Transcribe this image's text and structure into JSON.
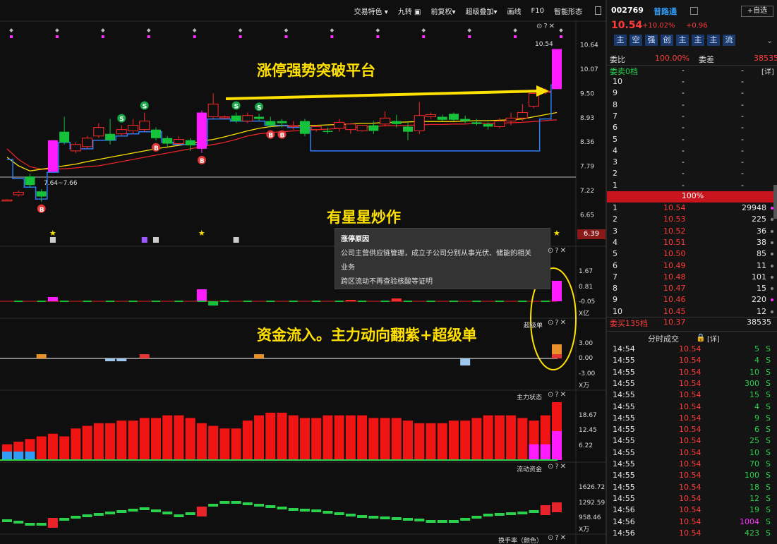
{
  "toolbar": {
    "items": [
      "交易特色",
      "九转",
      "前复权",
      "超级叠加",
      "画线",
      "F10",
      "智能形态"
    ]
  },
  "chart_data": {
    "type": "candlestick",
    "price_axis": [
      "10.64",
      "10.07",
      "9.50",
      "8.93",
      "8.36",
      "7.79",
      "7.22",
      "6.65"
    ],
    "price_range": [
      6.36,
      10.78
    ],
    "high_label": "10.54",
    "low_label": "7.64~7.66",
    "current_price_badge": "6.39",
    "candles": [
      {
        "o": 7.0,
        "c": 7.0,
        "h": 7.02,
        "l": 6.98
      },
      {
        "o": 7.12,
        "c": 7.18,
        "h": 7.22,
        "l": 7.08
      },
      {
        "o": 7.55,
        "c": 7.35,
        "h": 7.62,
        "l": 7.3
      },
      {
        "o": 7.2,
        "c": 7.08,
        "h": 7.25,
        "l": 6.96
      },
      {
        "o": 7.66,
        "c": 8.4,
        "h": 8.4,
        "l": 7.64
      },
      {
        "o": 8.6,
        "c": 8.35,
        "h": 8.95,
        "l": 8.3
      },
      {
        "o": 8.15,
        "c": 8.3,
        "h": 8.35,
        "l": 8.1
      },
      {
        "o": 8.25,
        "c": 8.45,
        "h": 8.5,
        "l": 8.2
      },
      {
        "o": 8.5,
        "c": 8.7,
        "h": 8.8,
        "l": 8.45
      },
      {
        "o": 8.55,
        "c": 8.4,
        "h": 8.9,
        "l": 8.3
      },
      {
        "o": 8.55,
        "c": 8.65,
        "h": 8.75,
        "l": 8.5
      },
      {
        "o": 8.62,
        "c": 8.75,
        "h": 8.9,
        "l": 8.55
      },
      {
        "o": 8.65,
        "c": 8.85,
        "h": 9.05,
        "l": 8.6
      },
      {
        "o": 8.65,
        "c": 8.45,
        "h": 8.7,
        "l": 8.4
      },
      {
        "o": 8.45,
        "c": 8.32,
        "h": 8.5,
        "l": 8.25
      },
      {
        "o": 8.32,
        "c": 8.42,
        "h": 8.5,
        "l": 8.3
      },
      {
        "o": 8.4,
        "c": 8.28,
        "h": 8.45,
        "l": 8.15
      },
      {
        "o": 8.2,
        "c": 9.05,
        "h": 9.1,
        "l": 8.1
      },
      {
        "o": 8.95,
        "c": 9.25,
        "h": 9.5,
        "l": 8.9
      },
      {
        "o": 8.95,
        "c": 8.95,
        "h": 8.98,
        "l": 8.9
      },
      {
        "o": 8.98,
        "c": 8.85,
        "h": 9.05,
        "l": 8.8
      },
      {
        "o": 8.85,
        "c": 8.98,
        "h": 9.05,
        "l": 8.8
      },
      {
        "o": 8.95,
        "c": 8.9,
        "h": 9.02,
        "l": 8.85
      },
      {
        "o": 8.85,
        "c": 8.75,
        "h": 8.95,
        "l": 8.7
      },
      {
        "o": 8.85,
        "c": 8.8,
        "h": 8.9,
        "l": 8.7
      },
      {
        "o": 8.72,
        "c": 8.75,
        "h": 8.85,
        "l": 8.65
      },
      {
        "o": 8.85,
        "c": 8.55,
        "h": 8.9,
        "l": 8.5
      },
      {
        "o": 8.65,
        "c": 8.72,
        "h": 8.75,
        "l": 8.6
      },
      {
        "o": 8.62,
        "c": 8.6,
        "h": 8.7,
        "l": 8.55
      },
      {
        "o": 8.68,
        "c": 8.82,
        "h": 8.9,
        "l": 8.6
      },
      {
        "o": 8.65,
        "c": 8.78,
        "h": 8.8,
        "l": 8.55
      },
      {
        "o": 8.62,
        "c": 8.75,
        "h": 8.75,
        "l": 8.6
      },
      {
        "o": 8.75,
        "c": 8.62,
        "h": 8.85,
        "l": 8.55
      },
      {
        "o": 8.78,
        "c": 8.92,
        "h": 9.08,
        "l": 8.72
      },
      {
        "o": 8.85,
        "c": 8.78,
        "h": 9.0,
        "l": 8.7
      },
      {
        "o": 8.72,
        "c": 8.6,
        "h": 8.85,
        "l": 8.4
      },
      {
        "o": 8.62,
        "c": 8.98,
        "h": 9.3,
        "l": 8.55
      },
      {
        "o": 8.95,
        "c": 9.0,
        "h": 9.05,
        "l": 8.9
      },
      {
        "o": 8.95,
        "c": 8.88,
        "h": 9.0,
        "l": 8.85
      },
      {
        "o": 9.02,
        "c": 8.88,
        "h": 9.05,
        "l": 8.85
      },
      {
        "o": 8.9,
        "c": 8.85,
        "h": 8.98,
        "l": 8.8
      },
      {
        "o": 8.82,
        "c": 8.78,
        "h": 8.9,
        "l": 8.75
      },
      {
        "o": 8.78,
        "c": 8.72,
        "h": 8.82,
        "l": 8.65
      },
      {
        "o": 8.72,
        "c": 8.85,
        "h": 8.92,
        "l": 8.68
      },
      {
        "o": 8.85,
        "c": 8.92,
        "h": 9.05,
        "l": 8.75
      },
      {
        "o": 8.92,
        "c": 9.05,
        "h": 9.25,
        "l": 8.85
      },
      {
        "o": 9.2,
        "c": 9.5,
        "h": 9.55,
        "l": 9.15
      },
      {
        "o": 9.52,
        "c": 9.55,
        "h": 9.62,
        "l": 9.48
      },
      {
        "o": 9.6,
        "c": 10.54,
        "h": 10.54,
        "l": 9.6
      }
    ],
    "ma_yellow": [
      8.0,
      7.8,
      7.68,
      7.72,
      7.76,
      7.8,
      7.84,
      7.9,
      7.95,
      8.0,
      8.05,
      8.1,
      8.15,
      8.2,
      8.24,
      8.28,
      8.32,
      8.38,
      8.42,
      8.48,
      8.55,
      8.62,
      8.68,
      8.72,
      8.74,
      8.74,
      8.74,
      8.75,
      8.76,
      8.77,
      8.78,
      8.8,
      8.8,
      8.82,
      8.82,
      8.83,
      8.84,
      8.84,
      8.84,
      8.84,
      8.85,
      8.86,
      8.86,
      8.87,
      8.88,
      8.9,
      8.95,
      9.0,
      9.05
    ],
    "ma_red": [
      8.2,
      7.95,
      7.78,
      7.72,
      7.72,
      7.73,
      7.75,
      7.78,
      7.8,
      7.85,
      7.9,
      7.95,
      8.0,
      8.05,
      8.1,
      8.15,
      8.2,
      8.25,
      8.3,
      8.35,
      8.42,
      8.5,
      8.55,
      8.58,
      8.6,
      8.62,
      8.63,
      8.65,
      8.66,
      8.68,
      8.7,
      8.71,
      8.72,
      8.74,
      8.74,
      8.75,
      8.76,
      8.77,
      8.77,
      8.78,
      8.78,
      8.8,
      8.8,
      8.8,
      8.81,
      8.82,
      8.84,
      8.86,
      8.88
    ],
    "stop_line_blue": [
      7.95,
      7.5,
      7.3,
      7.02,
      7.65,
      8.35,
      8.2,
      8.2,
      8.4,
      8.4,
      8.5,
      8.55,
      8.6,
      8.6,
      8.35,
      8.3,
      8.3,
      8.3,
      8.9,
      8.9,
      8.85,
      8.85,
      8.85,
      8.75,
      8.75,
      8.7,
      8.7,
      8.15,
      8.15,
      8.15,
      8.15,
      8.15,
      8.15,
      8.15,
      8.15,
      8.15,
      8.15,
      8.15,
      8.15,
      8.15,
      8.15,
      8.15,
      8.15,
      8.15,
      8.15,
      8.15,
      8.15,
      8.9,
      9.7
    ],
    "signals": [
      {
        "i": 3,
        "t": "B",
        "pos": "below"
      },
      {
        "i": 10,
        "t": "S",
        "pos": "above"
      },
      {
        "i": 12,
        "t": "S",
        "pos": "above"
      },
      {
        "i": 13,
        "t": "B",
        "pos": "below"
      },
      {
        "i": 17,
        "t": "B",
        "pos": "below"
      },
      {
        "i": 20,
        "t": "S",
        "pos": "above"
      },
      {
        "i": 22,
        "t": "S",
        "pos": "above"
      },
      {
        "i": 23,
        "t": "B",
        "pos": "below"
      },
      {
        "i": 24,
        "t": "B",
        "pos": "below"
      }
    ],
    "panel2_axis": [
      "1.67",
      "0.81",
      "-0.05",
      "X亿"
    ],
    "panel3": {
      "title": "超级单",
      "axis": [
        "3.00",
        "0.00",
        "-3.00",
        "X万"
      ]
    },
    "panel4": {
      "title": "主力状态",
      "axis": [
        "18.67",
        "12.45",
        "6.22"
      ],
      "bars": [
        6,
        7,
        8,
        9,
        10,
        9,
        12,
        13,
        14,
        14,
        15,
        15,
        16,
        16,
        17,
        17,
        16,
        14,
        13,
        12,
        12,
        15,
        17,
        18,
        18,
        17,
        16,
        16,
        17,
        17,
        17,
        17,
        16,
        16,
        16,
        15,
        14,
        14,
        14,
        15,
        15,
        16,
        17,
        17,
        17,
        16,
        15,
        17,
        22
      ],
      "magenta": [
        0,
        0,
        0,
        0,
        0,
        0,
        0,
        0,
        0,
        0,
        0,
        0,
        0,
        0,
        0,
        0,
        0,
        0,
        0,
        0,
        0,
        0,
        0,
        0,
        0,
        0,
        0,
        0,
        0,
        0,
        0,
        0,
        0,
        0,
        0,
        0,
        0,
        0,
        0,
        0,
        0,
        0,
        0,
        0,
        0,
        0,
        6,
        6,
        11
      ]
    },
    "panel5": {
      "title": "流动资金",
      "axis": [
        "1626.72",
        "1292.59",
        "958.46",
        "X万"
      ]
    },
    "panel6": {
      "title": "换手率（颜色）"
    }
  },
  "annotations": {
    "a1": "涨停强势突破平台",
    "a2": "有星星炒作",
    "a3": "资金流入。主力动向翻紫+超级单"
  },
  "tooltip": {
    "title": "涨停原因",
    "line1": "公司主营供应链管理，成立子公司分别从事光伏、储能的相关",
    "line2": "业务",
    "line3": "跨区流动不再查验核酸等证明"
  },
  "quote": {
    "code": "002769",
    "name": "普路通",
    "add_btn": "+自选",
    "price": "10.54",
    "pct": "+10.02%",
    "chg": "+0.96",
    "tags": [
      "主",
      "空",
      "强",
      "创",
      "主",
      "主",
      "主",
      "流"
    ],
    "weibi_label": "委比",
    "weibi": "100.00%",
    "weicha_label": "委差",
    "weicha": "38535",
    "sell_header": "委卖0档",
    "detail": "[详]",
    "sells": [
      {
        "n": "10",
        "p": "-",
        "v": "-"
      },
      {
        "n": "9",
        "p": "-",
        "v": "-"
      },
      {
        "n": "8",
        "p": "-",
        "v": "-"
      },
      {
        "n": "7",
        "p": "-",
        "v": "-"
      },
      {
        "n": "6",
        "p": "-",
        "v": "-"
      },
      {
        "n": "5",
        "p": "-",
        "v": "-"
      },
      {
        "n": "4",
        "p": "-",
        "v": "-"
      },
      {
        "n": "3",
        "p": "-",
        "v": "-"
      },
      {
        "n": "2",
        "p": "-",
        "v": "-"
      },
      {
        "n": "1",
        "p": "-",
        "v": "-"
      }
    ],
    "ratio": "100%",
    "buys": [
      {
        "n": "1",
        "p": "10.54",
        "v": "29948"
      },
      {
        "n": "2",
        "p": "10.53",
        "v": "225"
      },
      {
        "n": "3",
        "p": "10.52",
        "v": "36"
      },
      {
        "n": "4",
        "p": "10.51",
        "v": "38"
      },
      {
        "n": "5",
        "p": "10.50",
        "v": "85"
      },
      {
        "n": "6",
        "p": "10.49",
        "v": "11"
      },
      {
        "n": "7",
        "p": "10.48",
        "v": "101"
      },
      {
        "n": "8",
        "p": "10.47",
        "v": "15"
      },
      {
        "n": "9",
        "p": "10.46",
        "v": "220"
      },
      {
        "n": "10",
        "p": "10.45",
        "v": "12"
      }
    ],
    "buy_footer": "委买135档",
    "buy_footer_price": "10.37",
    "buy_footer_vol": "38535",
    "trades_header": "分时成交",
    "trades": [
      {
        "t": "14:54",
        "p": "10.54",
        "v": "5",
        "d": "S"
      },
      {
        "t": "14:55",
        "p": "10.54",
        "v": "4",
        "d": "S"
      },
      {
        "t": "14:55",
        "p": "10.54",
        "v": "10",
        "d": "S"
      },
      {
        "t": "14:55",
        "p": "10.54",
        "v": "300",
        "d": "S"
      },
      {
        "t": "14:55",
        "p": "10.54",
        "v": "15",
        "d": "S"
      },
      {
        "t": "14:55",
        "p": "10.54",
        "v": "4",
        "d": "S"
      },
      {
        "t": "14:55",
        "p": "10.54",
        "v": "9",
        "d": "S"
      },
      {
        "t": "14:55",
        "p": "10.54",
        "v": "6",
        "d": "S"
      },
      {
        "t": "14:55",
        "p": "10.54",
        "v": "25",
        "d": "S"
      },
      {
        "t": "14:55",
        "p": "10.54",
        "v": "10",
        "d": "S"
      },
      {
        "t": "14:55",
        "p": "10.54",
        "v": "70",
        "d": "S"
      },
      {
        "t": "14:55",
        "p": "10.54",
        "v": "100",
        "d": "S"
      },
      {
        "t": "14:55",
        "p": "10.54",
        "v": "18",
        "d": "S"
      },
      {
        "t": "14:55",
        "p": "10.54",
        "v": "12",
        "d": "S"
      },
      {
        "t": "14:56",
        "p": "10.54",
        "v": "19",
        "d": "S"
      },
      {
        "t": "14:56",
        "p": "10.54",
        "v": "1004",
        "d": "S"
      },
      {
        "t": "14:56",
        "p": "10.54",
        "v": "423",
        "d": "S"
      }
    ]
  },
  "colors": {
    "up": "#ff2a2a",
    "down": "#16c23a",
    "magenta": "#ff1dff",
    "yellow": "#ffe000",
    "blue": "#2f7df6"
  }
}
